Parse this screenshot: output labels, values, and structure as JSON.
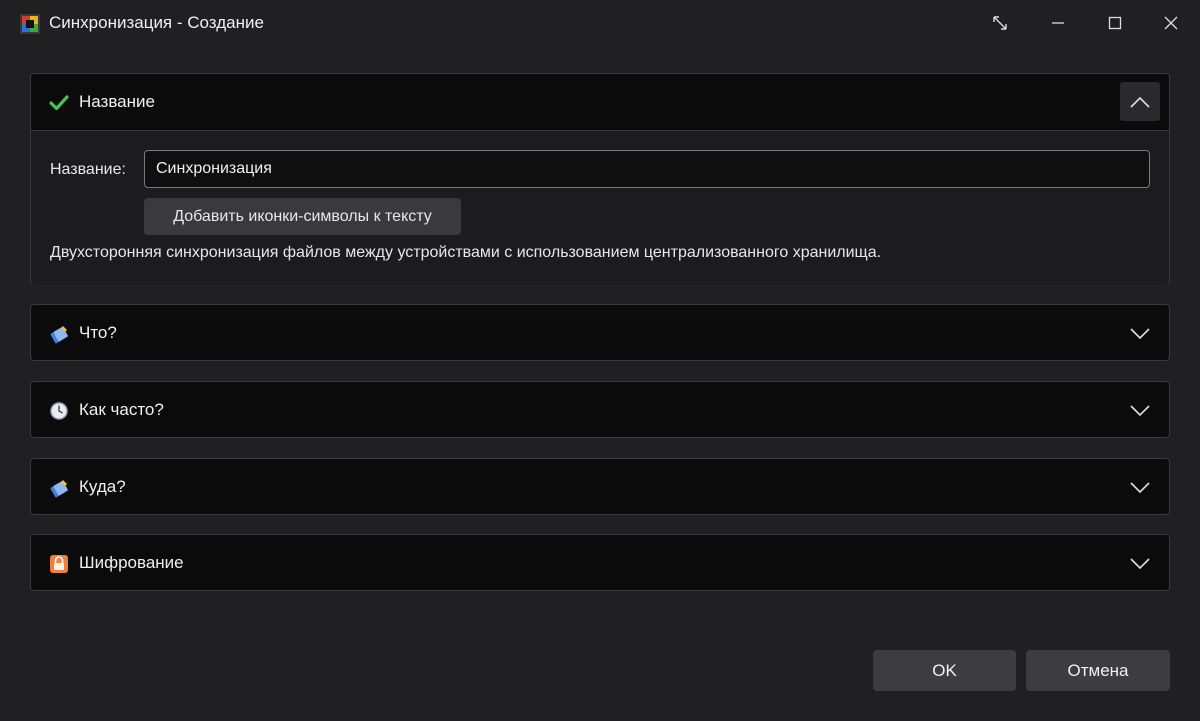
{
  "window": {
    "title": "Синхронизация - Создание",
    "app_icon": "backup-app-icon",
    "controls": [
      "resize-icon",
      "minimize-icon",
      "maximize-icon",
      "close-icon"
    ]
  },
  "sections": [
    {
      "id": "name",
      "title": "Название",
      "icon": "checkmark-icon",
      "expanded": true,
      "body": {
        "name_label": "Название:",
        "name_value": "Синхронизация",
        "symbols_button": "Добавить иконки-символы к тексту",
        "description": "Двухсторонняя синхронизация файлов между устройствами с использованием централизованного хранилища."
      }
    },
    {
      "id": "what",
      "title": "Что?",
      "icon": "files-icon",
      "expanded": false
    },
    {
      "id": "how_often",
      "title": "Как часто?",
      "icon": "clock-icon",
      "expanded": false
    },
    {
      "id": "where",
      "title": "Куда?",
      "icon": "files-icon",
      "expanded": false
    },
    {
      "id": "encryption",
      "title": "Шифрование",
      "icon": "lock-icon",
      "expanded": false
    }
  ],
  "footer": {
    "ok_label": "OK",
    "cancel_label": "Отмена"
  },
  "colors": {
    "background": "#202023",
    "section_header": "#0b0b0c",
    "section_body": "#1c1c1f",
    "button": "#3d3d41",
    "check_green": "#4cc24c"
  }
}
